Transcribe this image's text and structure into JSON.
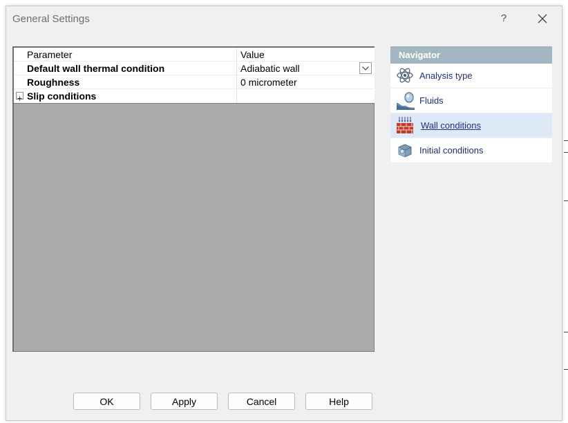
{
  "window": {
    "title": "General Settings",
    "help_glyph": "?"
  },
  "grid": {
    "header": {
      "param": "Parameter",
      "value": "Value"
    },
    "rows": [
      {
        "param": "Default wall thermal condition",
        "value": "Adiabatic wall"
      },
      {
        "param": "Roughness",
        "value": "0 micrometer"
      },
      {
        "param": "Slip conditions",
        "value": ""
      }
    ]
  },
  "navigator": {
    "header": "Navigator",
    "items": [
      {
        "label": "Analysis type",
        "icon": "atom-icon"
      },
      {
        "label": "Fluids",
        "icon": "fluid-flask-icon"
      },
      {
        "label": "Wall conditions",
        "icon": "wall-bricks-icon",
        "selected": true
      },
      {
        "label": "Initial conditions",
        "icon": "cube-initial-icon"
      }
    ]
  },
  "buttons": {
    "ok": "OK",
    "apply": "Apply",
    "cancel": "Cancel",
    "help": "Help"
  },
  "colors": {
    "navigator_header": "#a2b6c2",
    "selected_item": "#dde9f7",
    "link_text": "#1f2e80",
    "grid_empty": "#ababab"
  }
}
